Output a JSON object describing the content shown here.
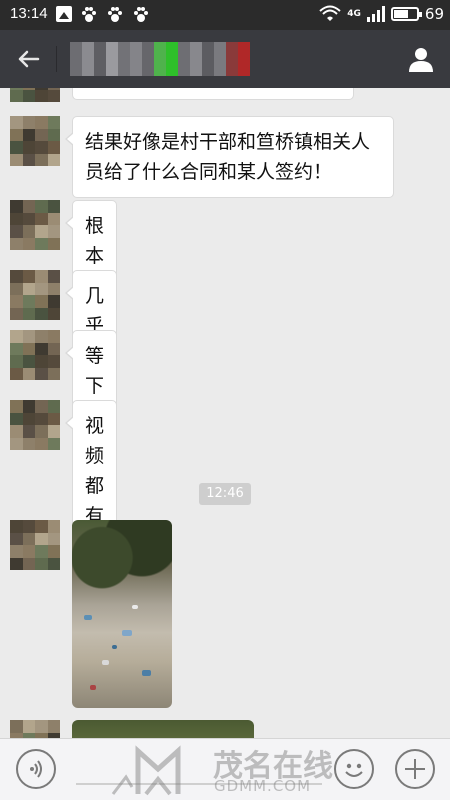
{
  "status_bar": {
    "time": "13:14",
    "network": "4G",
    "battery": "69"
  },
  "title_bar": {
    "back_icon": "back-arrow-icon",
    "profile_icon": "user-icon"
  },
  "messages": [
    {
      "text": ""
    },
    {
      "text": "结果好像是村干部和笪桥镇相关人员给了什么合同和某人签约！"
    },
    {
      "text": "根本不公开"
    },
    {
      "text": "几乎都是黑着来"
    },
    {
      "text": "等下我找照片给你"
    },
    {
      "text": "视频都有"
    }
  ],
  "timestamp": "12:46",
  "watermark": {
    "main": "茂名在线",
    "sub": "GDMM.COM"
  },
  "colors": {
    "title_bar": "#393a3f",
    "chat_bg": "#ebebeb",
    "bubble": "#ffffff"
  }
}
